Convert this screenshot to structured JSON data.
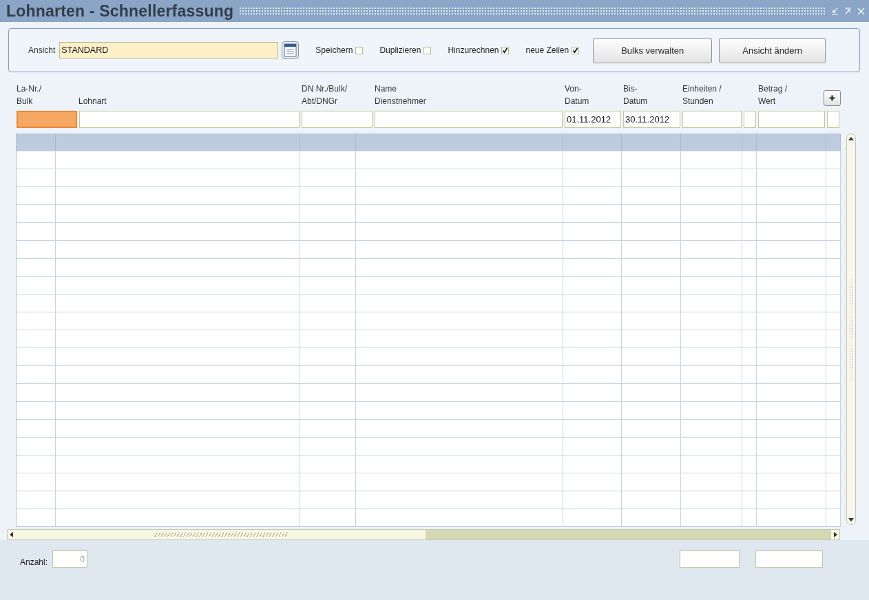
{
  "window": {
    "title": "Lohnarten - Schnellerfassung"
  },
  "toolbar": {
    "view_label": "Ansicht",
    "view_value": "STANDARD",
    "options": [
      {
        "label": "Speichern",
        "checked": false
      },
      {
        "label": "Duplizieren",
        "checked": false
      },
      {
        "label": "Hinzurechnen",
        "checked": true
      },
      {
        "label": "neue Zeilen",
        "checked": true
      }
    ],
    "buttons": [
      "Bulks verwalten",
      "Ansicht ändern"
    ]
  },
  "columns": [
    {
      "label": "La-Nr./\nBulk",
      "focused": true
    },
    {
      "label": "Lohnart",
      "focused": false
    },
    {
      "label": "DN Nr./Bulk/\nAbt/DNGr",
      "focused": false
    },
    {
      "label": "Name\nDienstnehmer",
      "focused": false
    },
    {
      "label": "Von-\nDatum",
      "filter": "01.11.2012",
      "focused": false
    },
    {
      "label": "Bis-\nDatum",
      "filter": "30.11.2012",
      "focused": false
    },
    {
      "label": "Einheiten /\nStunden",
      "focused": false
    },
    {
      "focused": false
    },
    {
      "label": "Betrag /\nWert",
      "focused": false
    },
    {
      "focused": false
    }
  ],
  "footer": {
    "count_label": "Anzahl:",
    "count_value": "0"
  }
}
